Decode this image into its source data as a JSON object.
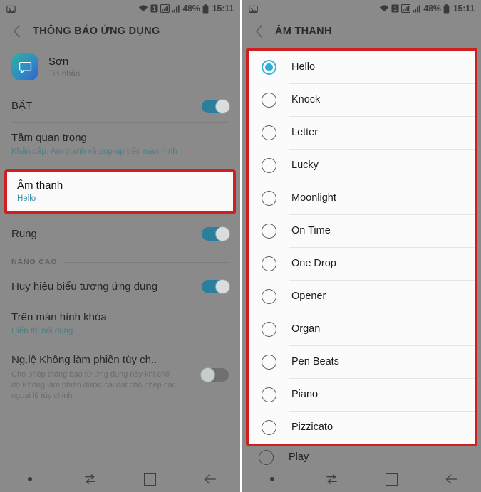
{
  "status_bar": {
    "image_icon": "photo-icon",
    "wifi_icon": "wifi-icon",
    "sim_icon": "sim-1-icon",
    "signal_icon_1": "signal-bars-icon",
    "signal_icon_2": "signal-bars-icon",
    "battery_percent": "48%",
    "battery_icon": "battery-icon",
    "time": "15:11"
  },
  "left_screen": {
    "back_icon": "back-chevron-icon",
    "title": "THÔNG BÁO ỨNG DỤNG",
    "app": {
      "icon": "messages-app-icon",
      "name": "Sơn",
      "subtitle": "Tin nhắn"
    },
    "rows": [
      {
        "title": "BẬT",
        "toggle": "on"
      },
      {
        "title": "Tầm quan trọng",
        "subtitle": "Khẩn cấp: Âm thanh và pop-up trên màn hình"
      },
      {
        "title": "Âm thanh",
        "subtitle": "Hello",
        "highlighted": true
      },
      {
        "title": "Rung",
        "toggle": "on"
      }
    ],
    "section_label": "NÂNG CAO",
    "advanced_rows": [
      {
        "title": "Huy hiệu biểu tượng ứng dụng",
        "toggle": "on"
      },
      {
        "title": "Trên màn hình khóa",
        "subtitle": "Hiển thị nội dung"
      },
      {
        "title": "Ng.lệ Không làm phiền tùy ch..",
        "description": "Cho phép thông báo từ ứng dụng này khi chế độ Không làm phiền được cài đặt cho phép các ngoại lệ tùy chỉnh.",
        "toggle": "off"
      }
    ]
  },
  "right_screen": {
    "back_icon": "back-chevron-icon",
    "title": "ÂM THANH",
    "selected_sound": "Hello",
    "sounds": [
      {
        "label": "Hello",
        "selected": true
      },
      {
        "label": "Knock",
        "selected": false
      },
      {
        "label": "Letter",
        "selected": false
      },
      {
        "label": "Lucky",
        "selected": false
      },
      {
        "label": "Moonlight",
        "selected": false
      },
      {
        "label": "On Time",
        "selected": false
      },
      {
        "label": "One Drop",
        "selected": false
      },
      {
        "label": "Opener",
        "selected": false
      },
      {
        "label": "Organ",
        "selected": false
      },
      {
        "label": "Pen Beats",
        "selected": false
      },
      {
        "label": "Piano",
        "selected": false
      },
      {
        "label": "Pizzicato",
        "selected": false
      }
    ],
    "partial_row": {
      "label": "Play",
      "selected": false
    }
  },
  "nav_bar": {
    "dot_icon": "dot-indicator-icon",
    "recents_icon": "recents-icon",
    "home_icon": "home-square-icon",
    "back_icon": "back-arrow-icon"
  },
  "colors": {
    "highlight_border": "#cf2020",
    "toggle_on": "#2b7e9e",
    "radio_selected": "#2cafd6",
    "link_text": "#4e7f86",
    "screen_background": "#8a8a8a"
  }
}
